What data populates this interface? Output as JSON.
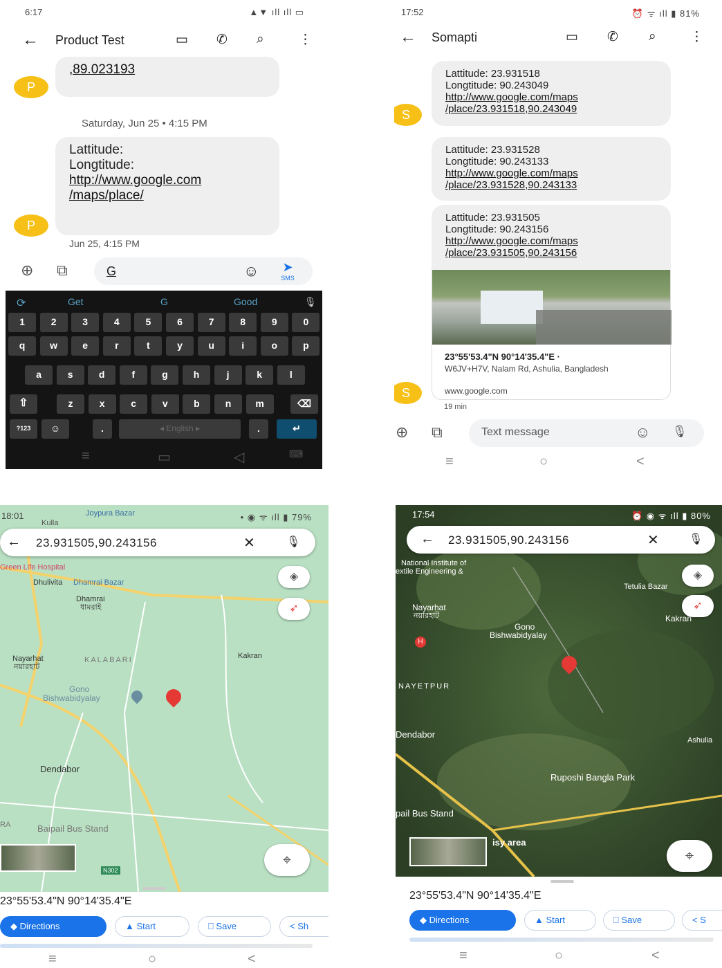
{
  "p1": {
    "status_time": "6:17",
    "status_icons": "▲▼ ıll ıll ▭",
    "header_title": "Product Test",
    "bubble1_text": ",89.023193",
    "date_divider": "Saturday, Jun 25 • 4:15 PM",
    "bubble2": {
      "lat": "Lattitude:",
      "lng": "Longtitude:",
      "link1": "http://www.google.com",
      "link2": "/maps/place/"
    },
    "avatar_letter": "P",
    "timestamp": "Jun 25, 4:15 PM",
    "compose_text": "G",
    "send_label": "SMS",
    "kb_suggestions": [
      "Get",
      "G",
      "Good"
    ],
    "kb_rows": [
      [
        "1",
        "2",
        "3",
        "4",
        "5",
        "6",
        "7",
        "8",
        "9",
        "0"
      ],
      [
        "q",
        "w",
        "e",
        "r",
        "t",
        "y",
        "u",
        "i",
        "o",
        "p"
      ],
      [
        "a",
        "s",
        "d",
        "f",
        "g",
        "h",
        "j",
        "k",
        "l"
      ],
      [
        "z",
        "x",
        "c",
        "v",
        "b",
        "n",
        "m"
      ]
    ],
    "kb_space": "◂  English  ▸",
    "kb_sym": "?123"
  },
  "p2": {
    "status_time": "17:52",
    "status_icons": "⏰ ᯤ ıll ▮ 81%",
    "header_title": "Somapti",
    "messages": [
      {
        "lat": "Lattitude: 23.931518",
        "lng": "Longtitude: 90.243049",
        "link1": "http://www.google.com/maps",
        "link2": "/place/23.931518,90.243049"
      },
      {
        "lat": "Lattitude: 23.931528",
        "lng": "Longtitude: 90.243133",
        "link1": "http://www.google.com/maps",
        "link2": "/place/23.931528,90.243133"
      },
      {
        "lat": "Lattitude: 23.931505",
        "lng": "Longtitude: 90.243156",
        "link1": "http://www.google.com/maps",
        "link2": "/place/23.931505,90.243156"
      }
    ],
    "preview": {
      "title": "23°55'53.4\"N 90°14'35.4\"E ·",
      "address": "W6JV+H7V, Nalam Rd, Ashulia, Bangladesh",
      "domain": "www.google.com"
    },
    "avatar_letter": "S",
    "timestamp": "19 min",
    "placeholder": "Text message"
  },
  "p3": {
    "status_time": "18:01",
    "status_icons": "• ◉ ᯤ ıll ▮ 79%",
    "search_value": "23.931505,90.243156",
    "labels": [
      "Kulla",
      "Joypura Bazar",
      "Green Life Hospital",
      "Dhulivita",
      "Dhamrai Bazar",
      "Dhamrai",
      "ধামরাই",
      "Nayarhat",
      "নয়ারহাট",
      "KALABARI",
      "Kakran",
      "Gono",
      "Bishwabidyalay",
      "Dendabor",
      "Baipail Bus Stand",
      "RA",
      "N302"
    ],
    "coords": "23°55'53.4\"N 90°14'35.4\"E",
    "chips": [
      "Directions",
      "Start",
      "Save",
      "Sh"
    ]
  },
  "p4": {
    "status_time": "17:54",
    "status_icons": "⏰ ◉ ᯤ ıll ▮ 80%",
    "search_value": "23.931505,90.243156",
    "labels": [
      "National Institute of",
      "extile Engineering &",
      "Tetulia Bazar",
      "Nayarhat",
      "নয়ারহাট",
      "Kakran",
      "Gono",
      "Bishwabidyalay",
      "NAYETPUR",
      "Dendabor",
      "Ashulia",
      "Ruposhi Bangla Park",
      "pail Bus Stand",
      "isy area"
    ],
    "coords": "23°55'53.4\"N 90°14'35.4\"E",
    "chips": [
      "Directions",
      "Start",
      "Save",
      "S"
    ]
  },
  "colors": {
    "accent_blue": "#1a73e8",
    "avatar_yellow": "#f6c017",
    "map_green": "#a8dab5",
    "pin_red": "#e53935"
  }
}
